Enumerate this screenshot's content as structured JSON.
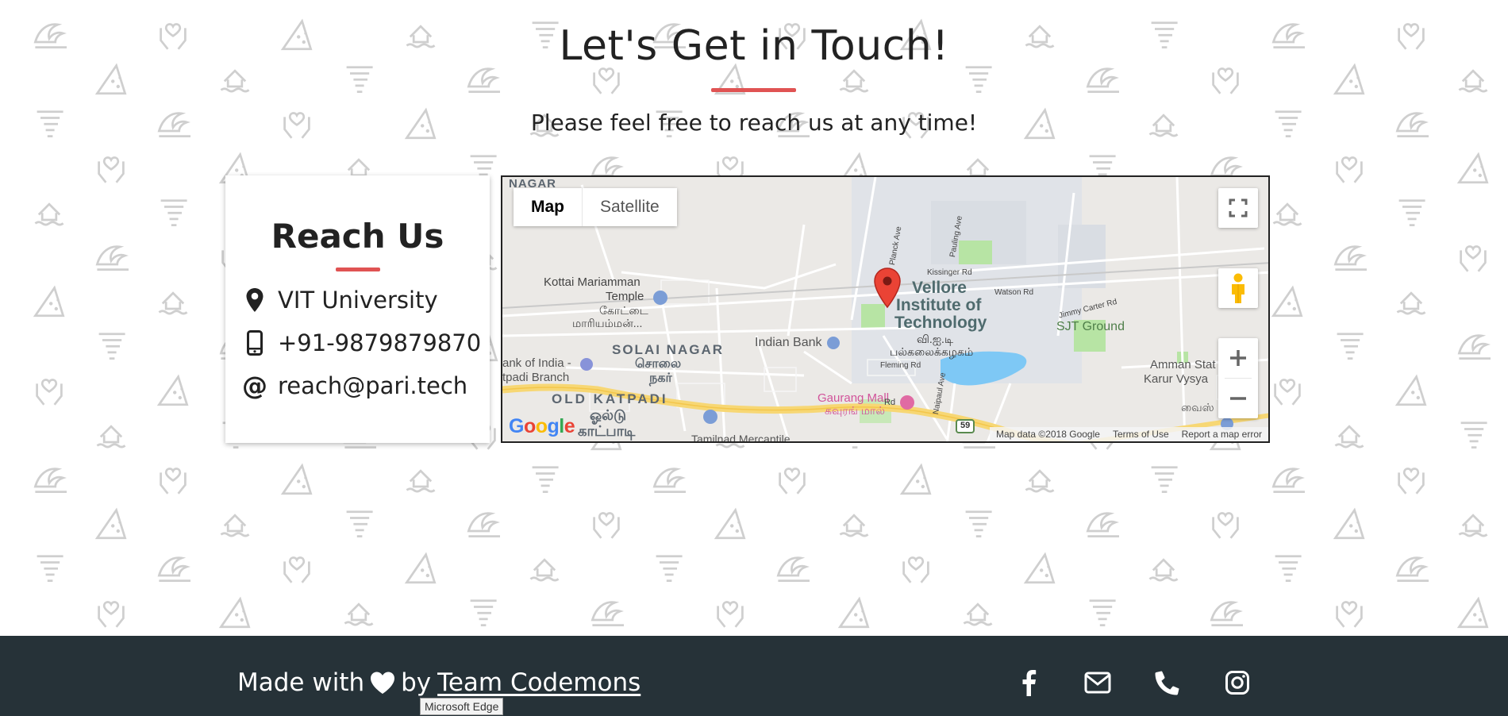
{
  "header": {
    "title": "Let's Get in Touch!",
    "subtitle": "Please feel free to reach us at any time!"
  },
  "reach_card": {
    "title": "Reach Us",
    "items": [
      {
        "icon": "location-pin-icon",
        "text": "VIT University"
      },
      {
        "icon": "mobile-phone-icon",
        "text": "+91-9879879870"
      },
      {
        "icon": "at-sign-icon",
        "text": "reach@pari.tech"
      }
    ]
  },
  "map": {
    "type_buttons": [
      "Map",
      "Satellite"
    ],
    "selected_type": "Map",
    "labels": {
      "nagar": "NAGAR",
      "kottai": "Kottai Mariamman",
      "temple": "Temple",
      "kottai_ta1": "கோட்டை",
      "kottai_ta2": "மாரியம்மன்...",
      "solai": "SOLAI NAGAR",
      "solai_ta1": "சொலை",
      "solai_ta2": "நகர்",
      "old_katpadi": "OLD KATPADI",
      "old_ta1": "ஓல்டு",
      "old_ta2": "காட்பாடி",
      "bank_of_india": "ank of India -",
      "katpadi_branch": "tpadi Branch",
      "indian_bank": "Indian Bank",
      "vit1": "Vellore",
      "vit2": "Institute of",
      "vit3": "Technology",
      "vit_ta1": "வி.ஐ.டி",
      "vit_ta2": "பல்கலைக்கழகம்",
      "sjt": "SJT Ground",
      "gaurang": "Gaurang Mall",
      "gaurang_ta": "கவுரங் மால்",
      "amman1": "Amman Stat",
      "amman2": "Karur Vysya",
      "vais": "வைஸ்",
      "tamilnad": "Tamilnad Mercantile",
      "watson": "Watson Rd",
      "jimmy": "Jimmy Carter Rd",
      "kissinger": "Kissinger Rd",
      "pauling": "Pauling Ave",
      "planck": "Planck Ave",
      "fleming": "Fleming Rd",
      "naipaul": "Naipaul Ave",
      "rd": "Rd",
      "route": "59"
    },
    "footer": {
      "data": "Map data ©2018 Google",
      "terms": "Terms of Use",
      "report": "Report a map error"
    },
    "logo": [
      "G",
      "o",
      "o",
      "g",
      "l",
      "e"
    ]
  },
  "footer": {
    "made_with": "Made with",
    "by": "by",
    "team": "Team Codemons",
    "social": [
      "facebook-icon",
      "envelope-icon",
      "phone-icon",
      "instagram-icon"
    ]
  },
  "tooltip": {
    "text": "Microsoft Edge"
  },
  "colors": {
    "accent": "#e05353",
    "footer_bg": "#263238",
    "pattern": "#cfcfcf"
  }
}
